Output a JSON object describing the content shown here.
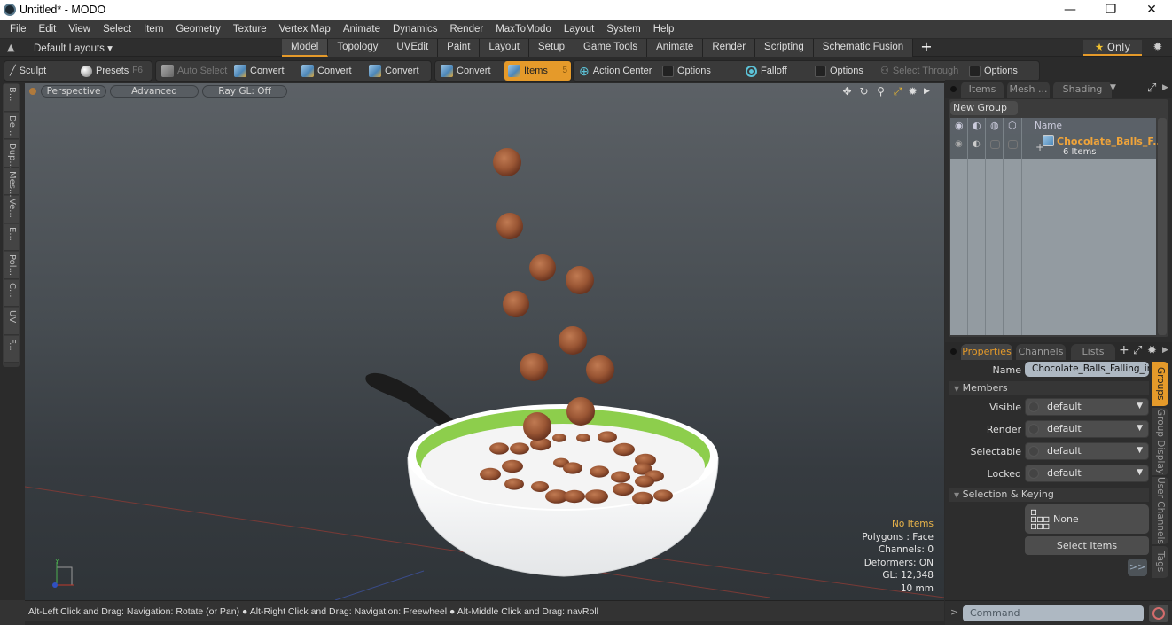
{
  "window": {
    "title": "Untitled* - MODO",
    "minimize_glyph": "—",
    "maximize_glyph": "❐",
    "close_glyph": "✕"
  },
  "menubar": [
    "File",
    "Edit",
    "View",
    "Select",
    "Item",
    "Geometry",
    "Texture",
    "Vertex Map",
    "Animate",
    "Dynamics",
    "Render",
    "MaxToModo",
    "Layout",
    "System",
    "Help"
  ],
  "layoutbar": {
    "default_layouts": "Default Layouts ▾",
    "tabs": [
      {
        "label": "Model",
        "active": true
      },
      {
        "label": "Topology"
      },
      {
        "label": "UVEdit"
      },
      {
        "label": "Paint"
      },
      {
        "label": "Layout"
      },
      {
        "label": "Setup"
      },
      {
        "label": "Game Tools"
      },
      {
        "label": "Animate"
      },
      {
        "label": "Render"
      },
      {
        "label": "Scripting"
      },
      {
        "label": "Schematic Fusion"
      }
    ],
    "add_tab": "+",
    "only_label": "Only",
    "only_star": "★"
  },
  "toolbar": {
    "sculpt": "Sculpt",
    "presets": "Presets",
    "presets_key": "F6",
    "auto_select": "Auto Select",
    "convert": [
      "Convert",
      "Convert",
      "Convert",
      "Convert"
    ],
    "items": "Items",
    "items_count": "5",
    "action_center": "Action Center",
    "options1": "Options",
    "falloff": "Falloff",
    "options2": "Options",
    "select_through": "Select Through",
    "options3": "Options"
  },
  "left_tabs": [
    "B...",
    "De...",
    "Dup...",
    "Mes...",
    "Ve...",
    "E...",
    "Pol...",
    "C...",
    "UV",
    "F..."
  ],
  "viewport": {
    "view_mode": "Perspective",
    "advanced": "Advanced",
    "raygl": "Ray GL: Off",
    "info": {
      "selection": "No Items",
      "polygons": "Polygons : Face",
      "channels": "Channels: 0",
      "deformers": "Deformers: ON",
      "gl": "GL: 12,348",
      "unit": "10 mm"
    },
    "axis_label": "Y",
    "colors": {
      "bowl_rim": "#8dce4c",
      "milk": "#f4f4f4",
      "ball": "#9a5634",
      "spoon": "#1c1c1c",
      "grid_red": "#8a3a38",
      "grid_blue": "#3a4c8a"
    }
  },
  "statusbar": {
    "hint1": "Alt-Left Click and Drag: Navigation: Rotate (or Pan)",
    "hint2": "Alt-Right Click and Drag: Navigation: Freewheel",
    "hint3": "Alt-Middle Click and Drag: navRoll",
    "separator": "●"
  },
  "items_panel": {
    "tabs": [
      "Items",
      "Mesh ...",
      "Shading"
    ],
    "new_group": "New Group",
    "column_name": "Name",
    "rows": [
      {
        "name": "Chocolate_Balls_F...",
        "subtitle": "6 Items"
      }
    ]
  },
  "properties_panel": {
    "tabs": [
      "Properties",
      "Channels",
      "Lists"
    ],
    "name_label": "Name",
    "name_value": "Chocolate_Balls_Falling_into",
    "members_section": "Members",
    "fields": [
      {
        "label": "Visible",
        "value": "default"
      },
      {
        "label": "Render",
        "value": "default"
      },
      {
        "label": "Selectable",
        "value": "default"
      },
      {
        "label": "Locked",
        "value": "default"
      }
    ],
    "selection_section": "Selection & Keying",
    "none_label": "None",
    "select_items": "Select Items",
    "more": ">>",
    "side_tabs": [
      {
        "label": "Groups",
        "active": true
      },
      {
        "label": "Group Display"
      },
      {
        "label": "User Channels"
      },
      {
        "label": "Tags"
      }
    ]
  },
  "command": {
    "prompt": ">",
    "placeholder": "Command"
  },
  "colors": {
    "accent": "#e59a2a",
    "selected_item": "#f0a43a"
  }
}
